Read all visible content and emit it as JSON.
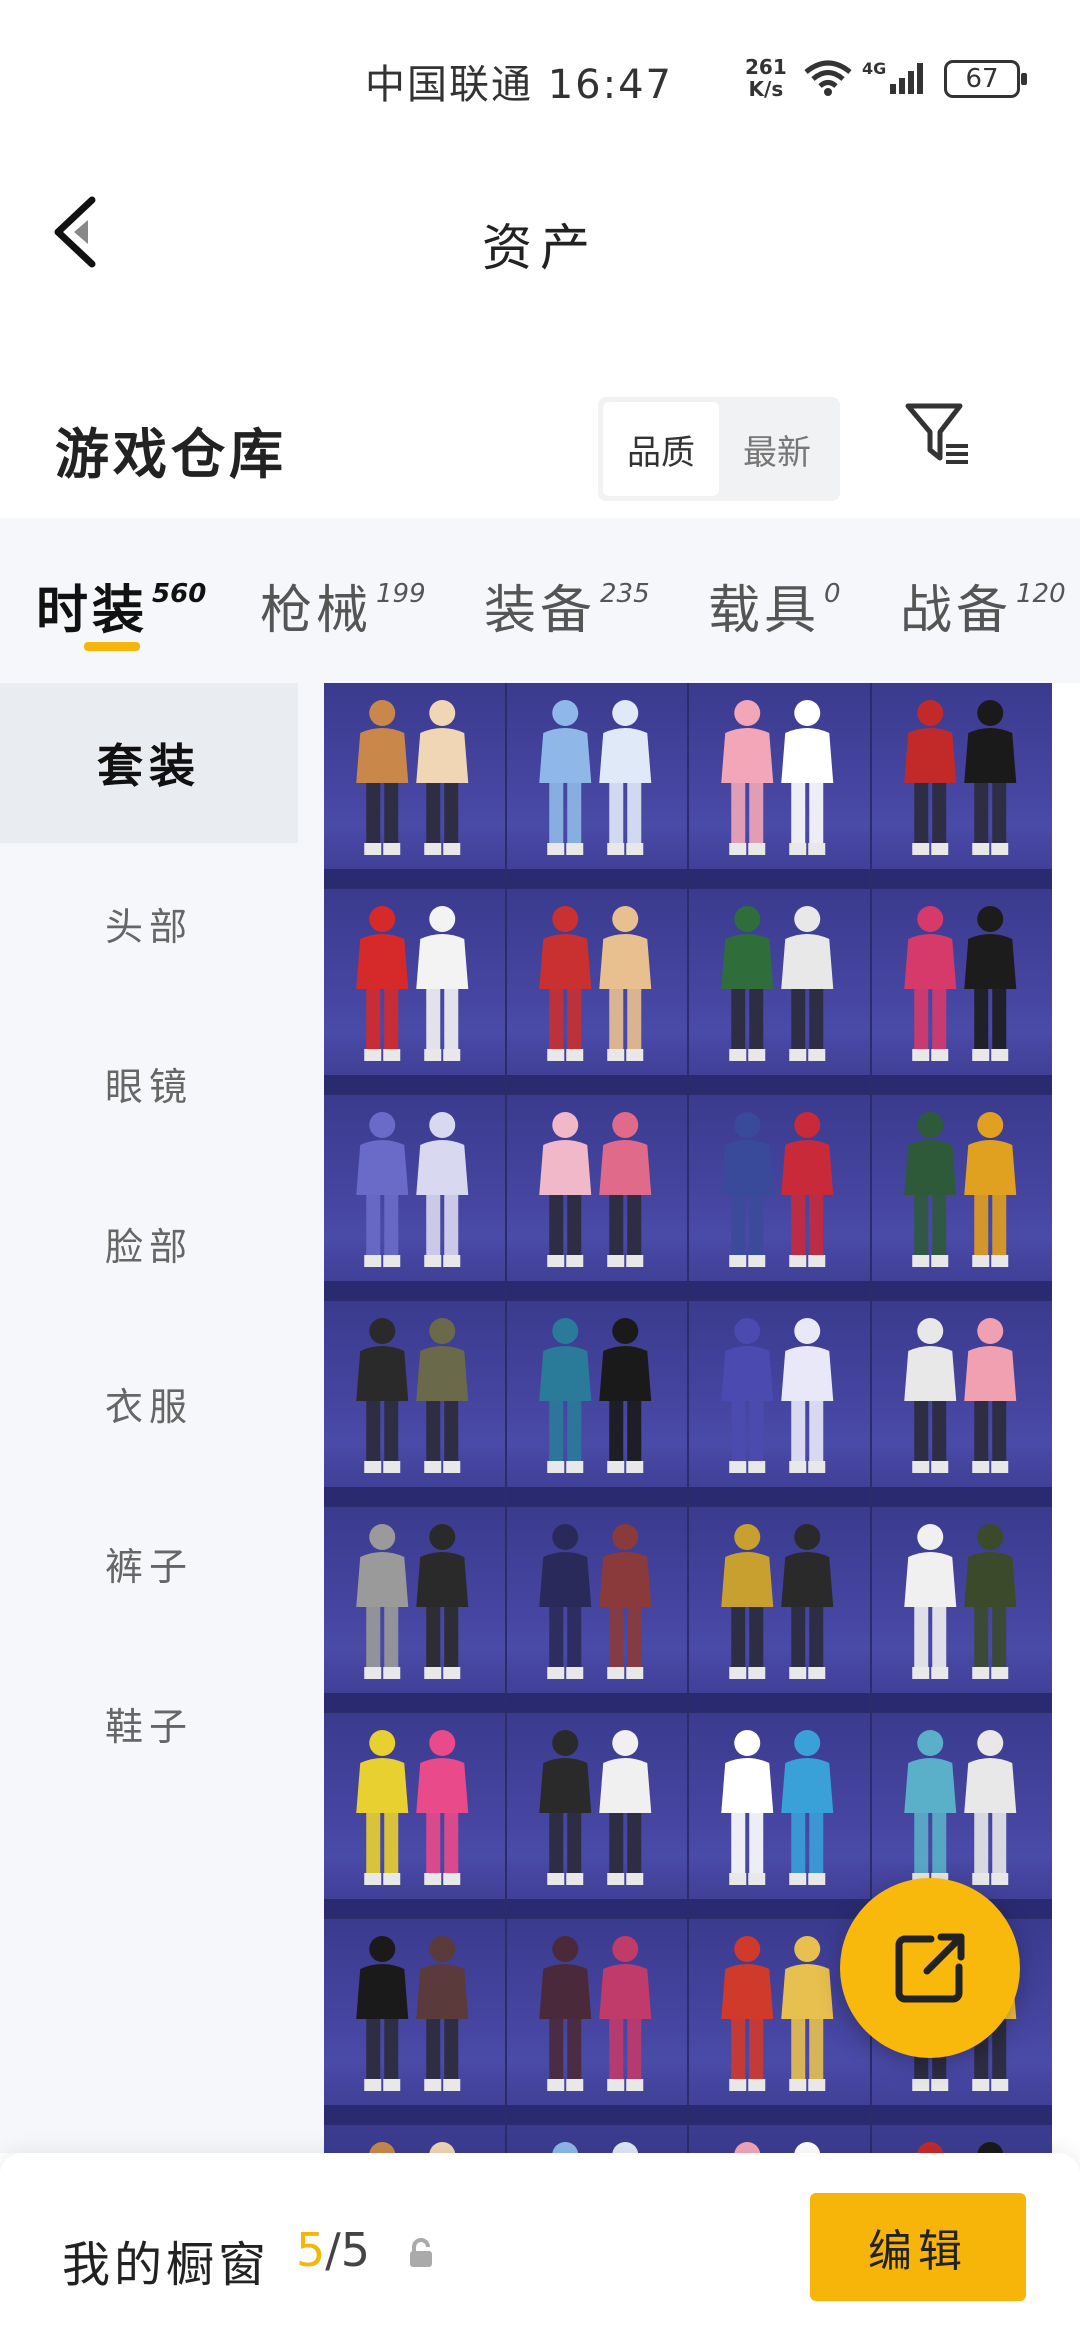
{
  "status_bar": {
    "carrier_time": "中国联通 16:47",
    "speed_value": "261",
    "speed_unit": "K/s",
    "network": "4G",
    "battery": "67"
  },
  "header": {
    "back_icon": "chevron-left-icon",
    "title": "资产"
  },
  "warehouse": {
    "title": "游戏仓库",
    "sort_options": [
      "品质",
      "最新"
    ],
    "selected_sort": "品质",
    "filter_icon": "filter-icon"
  },
  "tabs": [
    {
      "label": "时装",
      "count": "560",
      "active": true
    },
    {
      "label": "枪械",
      "count": "199",
      "active": false
    },
    {
      "label": "装备",
      "count": "235",
      "active": false
    },
    {
      "label": "载具",
      "count": "0",
      "active": false
    },
    {
      "label": "战备",
      "count": "120",
      "active": false
    }
  ],
  "sidebar": [
    {
      "label": "套装",
      "active": true
    },
    {
      "label": "头部",
      "active": false
    },
    {
      "label": "眼镜",
      "active": false
    },
    {
      "label": "脸部",
      "active": false
    },
    {
      "label": "衣服",
      "active": false
    },
    {
      "label": "裤子",
      "active": false
    },
    {
      "label": "鞋子",
      "active": false
    }
  ],
  "grid_rows_visible": 8,
  "grid_cols": 4,
  "colors": {
    "accent": "#f5b50a",
    "grid_bg": "#3a3a8e",
    "sidebar_bg": "#f5f7fa"
  },
  "fab_icon": "share-external-icon",
  "bottom": {
    "label": "我的橱窗",
    "current": "5",
    "total": "/5",
    "lock_icon": "lock-icon",
    "edit_label": "编辑"
  }
}
